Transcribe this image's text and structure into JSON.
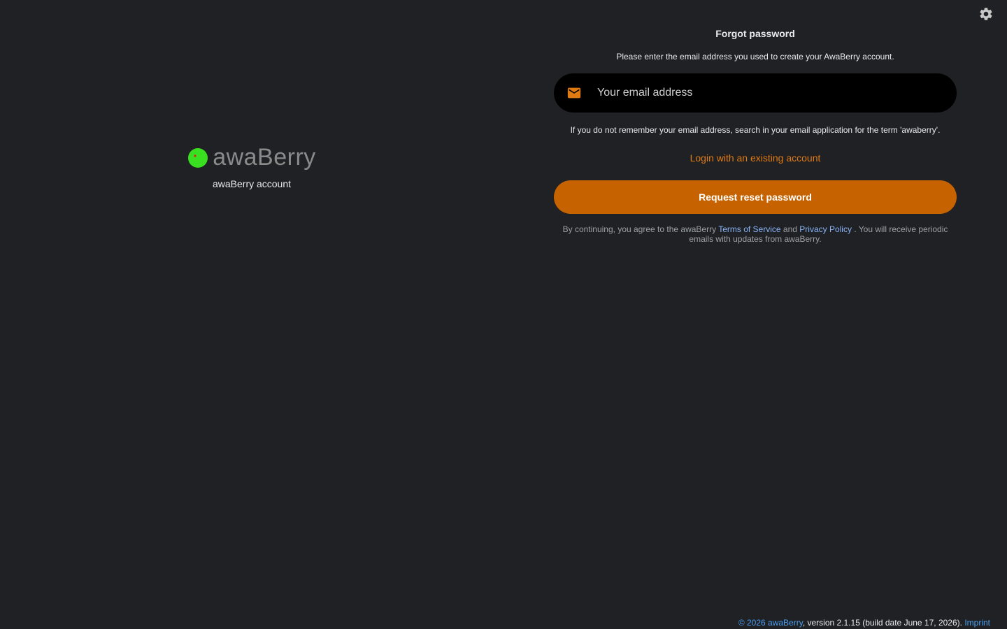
{
  "brand": {
    "name": "awaBerry",
    "subtitle": "awaBerry account",
    "logo_color": "#39e01f",
    "logo_dot_color": "#d92424"
  },
  "settings": {
    "icon": "gear-icon"
  },
  "form": {
    "title": "Forgot password",
    "instruction": "Please enter the email address you used to create your AwaBerry account.",
    "email": {
      "icon": "mail-icon",
      "value": "",
      "placeholder": "Your email address"
    },
    "hint": "If you do not remember your email address, search in your email application for the term 'awaberry'.",
    "login_link": "Login with an existing account",
    "submit_label": "Request reset password",
    "legal": {
      "prefix": "By continuing, you agree to the awaBerry",
      "terms": "Terms of Service",
      "and": "and",
      "privacy": "Privacy Policy",
      "suffix": ". You will receive periodic emails with updates from awaBerry."
    }
  },
  "footer": {
    "copyright": "© 2026 awaBerry",
    "version": ", version 2.1.15 (build date June 17, 2026).",
    "imprint": "Imprint"
  },
  "colors": {
    "accent": "#e07a12",
    "button": "#c66300",
    "link": "#8ab4f8",
    "background": "#202124"
  }
}
